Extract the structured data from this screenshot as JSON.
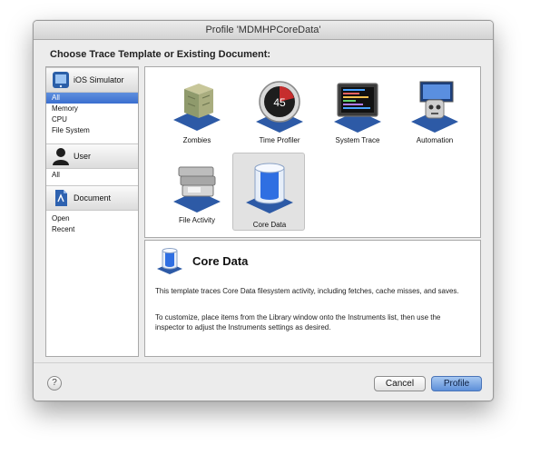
{
  "window": {
    "title": "Profile 'MDMHPCoreData'"
  },
  "heading": "Choose Trace Template or Existing Document:",
  "sidebar": {
    "sections": [
      {
        "label": "iOS Simulator",
        "icon": "ios-simulator-icon",
        "items": [
          "All",
          "Memory",
          "CPU",
          "File System"
        ],
        "selected": "All"
      },
      {
        "label": "User",
        "icon": "user-icon",
        "items": [
          "All"
        ]
      },
      {
        "label": "Document",
        "icon": "document-icon",
        "items": [
          "Open",
          "Recent"
        ]
      }
    ]
  },
  "templates": [
    {
      "label": "Zombies",
      "icon": "zombies-icon"
    },
    {
      "label": "Time Profiler",
      "icon": "time-profiler-icon",
      "clock_text": "45"
    },
    {
      "label": "System Trace",
      "icon": "system-trace-icon"
    },
    {
      "label": "Automation",
      "icon": "automation-icon"
    },
    {
      "label": "File Activity",
      "icon": "file-activity-icon"
    },
    {
      "label": "Core Data",
      "icon": "core-data-icon",
      "selected": true
    }
  ],
  "description": {
    "title": "Core Data",
    "paragraph1": "This template traces Core Data filesystem activity, including fetches, cache misses, and saves.",
    "paragraph2": "To customize, place items from the Library window onto the Instruments list, then use the inspector to adjust the Instruments settings as desired."
  },
  "buttons": {
    "help": "?",
    "cancel": "Cancel",
    "profile": "Profile"
  },
  "colors": {
    "selection": "#3a6fcf",
    "default_button": "#5d8fd9"
  }
}
